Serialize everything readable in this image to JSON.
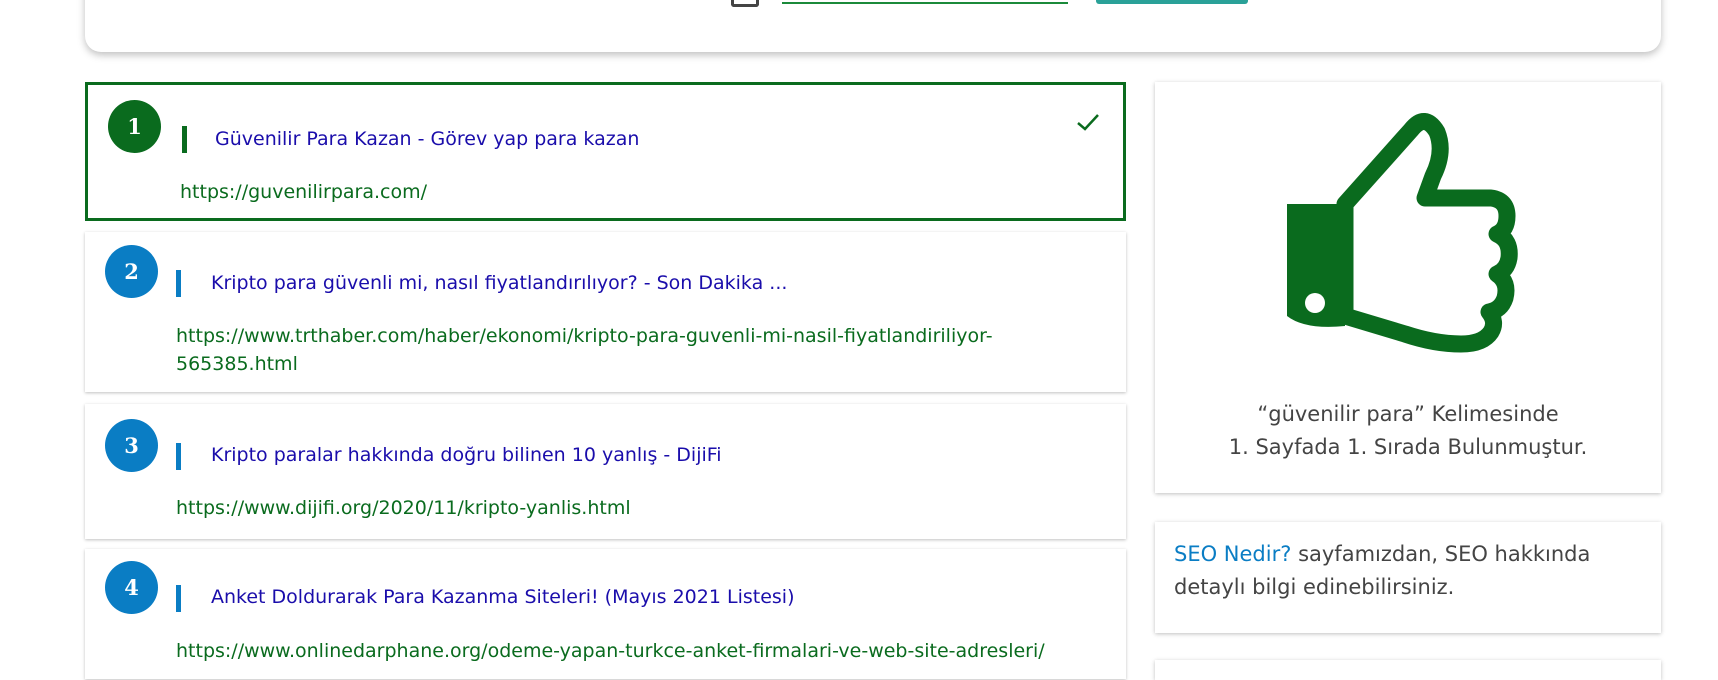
{
  "results": [
    {
      "rank": "1",
      "title": "Güvenilir Para Kazan - Görev yap para kazan",
      "url": "https://guvenilirpara.com/",
      "active": true
    },
    {
      "rank": "2",
      "title": "Kripto para güvenli mi, nasıl fiyatlandırılıyor? - Son Dakika ...",
      "url": "https://www.trthaber.com/haber/ekonomi/kripto-para-guvenli-mi-nasil-fiyatlandiriliyor-565385.html",
      "active": false
    },
    {
      "rank": "3",
      "title": "Kripto paralar hakkında doğru bilinen 10 yanlış - DijiFi",
      "url": "https://www.dijifi.org/2020/11/kripto-yanlis.html",
      "active": false
    },
    {
      "rank": "4",
      "title": "Anket Doldurarak Para Kazanma Siteleri! (Mayıs 2021 Listesi)",
      "url": "https://www.onlinedarphane.org/odeme-yapan-turkce-anket-firmalari-ve-web-site-adresleri/",
      "active": false
    }
  ],
  "summary": {
    "line1": "“güvenilir para” Kelimesinde",
    "line2": "1. Sayfada 1. Sırada Bulunmuştur.",
    "icon": "thumbs-up-icon"
  },
  "seo": {
    "link": "SEO Nedir?",
    "text": " sayfamızdan, SEO hakkında detaylı bilgi edinebilirsiniz."
  },
  "colors": {
    "green": "#0a6b1e",
    "blue": "#0a7dc4",
    "title": "#1a0dab"
  }
}
